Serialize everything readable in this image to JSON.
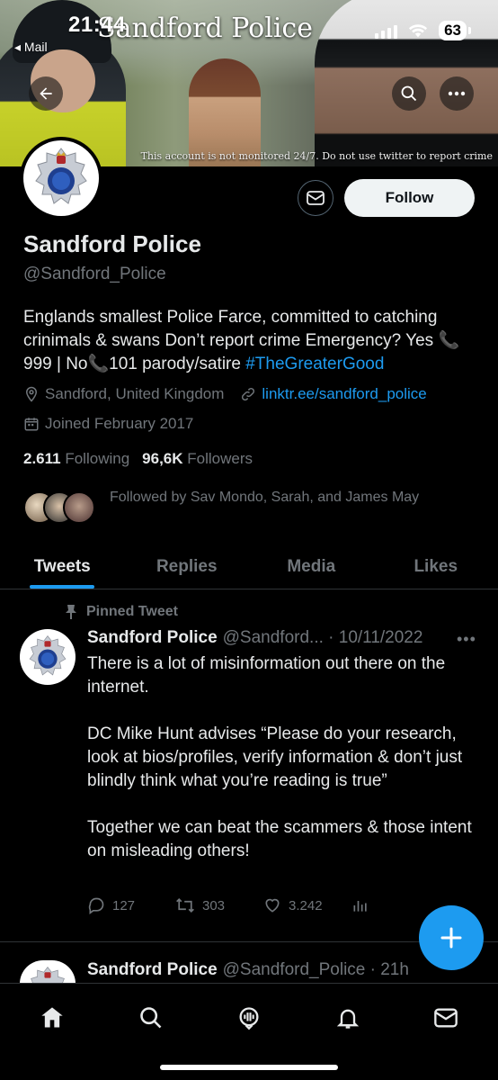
{
  "status_bar": {
    "time": "21:44",
    "back_label": "◂ Mail",
    "battery": "63"
  },
  "banner": {
    "title": "Sandford Police",
    "caption": "This account is not monitored 24/7. Do not use twitter to report crime"
  },
  "profile": {
    "name": "Sandford Police",
    "handle": "@Sandford_Police",
    "follow_label": "Follow",
    "bio_text": "Englands smallest Police Farce, committed to catching crinimals & swans Don’t report crime Emergency? Yes 📞999 | No📞101 parody/satire ",
    "bio_hashtag": "#TheGreaterGood",
    "location": "Sandford, United Kingdom",
    "website": "linktr.ee/sandford_police",
    "joined": "Joined February 2017",
    "following_count": "2.611",
    "following_label": "Following",
    "followers_count": "96,6K",
    "followers_label": "Followers",
    "followed_by": "Followed by Sav Mondo, Sarah, and James May"
  },
  "tabs": [
    {
      "label": "Tweets",
      "active": true
    },
    {
      "label": "Replies",
      "active": false
    },
    {
      "label": "Media",
      "active": false
    },
    {
      "label": "Likes",
      "active": false
    }
  ],
  "pinned_tweet": {
    "pinned_label": "Pinned Tweet",
    "name": "Sandford Police",
    "handle_date": "@Sandford... · 10/11/2022",
    "body": "There is a lot of misinformation out there on the internet.\n\nDC Mike Hunt advises “Please do your research, look at bios/profiles, verify information & don’t just blindly think what you’re reading is true”\n\nTogether we can beat the scammers & those intent on misleading others!",
    "replies": "127",
    "retweets": "303",
    "likes": "3.242"
  },
  "next_tweet": {
    "name": "Sandford Police",
    "handle_date": "@Sandford_Police · 21h"
  },
  "colors": {
    "accent": "#1d9bf0",
    "background": "#000000",
    "muted": "#71767b"
  },
  "icons": [
    "back-arrow-icon",
    "search-icon",
    "more-icon",
    "mail-icon",
    "location-icon",
    "link-icon",
    "calendar-icon",
    "pin-icon",
    "reply-icon",
    "retweet-icon",
    "like-icon",
    "views-icon",
    "compose-plus-icon",
    "home-icon",
    "spaces-icon",
    "bell-icon",
    "messages-icon"
  ]
}
